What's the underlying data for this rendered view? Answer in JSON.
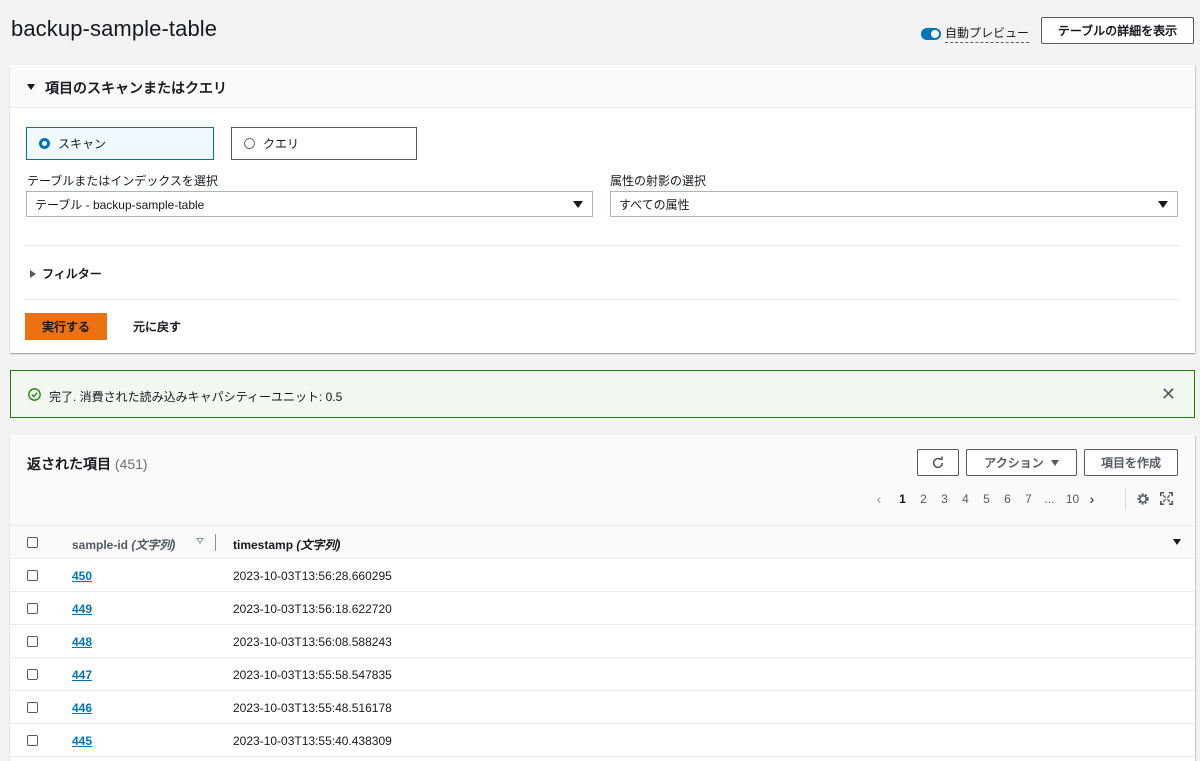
{
  "header": {
    "title": "backup-sample-table",
    "auto_preview_label": "自動プレビュー",
    "details_button": "テーブルの詳細を表示"
  },
  "scan_panel": {
    "title": "項目のスキャンまたはクエリ",
    "mode_scan": "スキャン",
    "mode_query": "クエリ",
    "selected_mode": "スキャン",
    "table_label": "テーブルまたはインデックスを選択",
    "table_value": "テーブル - backup-sample-table",
    "projection_label": "属性の射影の選択",
    "projection_value": "すべての属性",
    "filter_label": "フィルター",
    "run_button": "実行する",
    "reset_button": "元に戻す"
  },
  "flash": {
    "message": "完了. 消費された読み込みキャパシティーユニット: 0.5",
    "status_color": "#1d8102"
  },
  "results": {
    "title": "返された項目",
    "count": "(451)",
    "action_button": "アクション",
    "create_button": "項目を作成",
    "pagination": {
      "pages": [
        "1",
        "2",
        "3",
        "4",
        "5",
        "6",
        "7",
        "...",
        "10"
      ],
      "current": "1"
    },
    "columns": {
      "id": "sample-id",
      "id_type": "(文字列)",
      "timestamp": "timestamp",
      "timestamp_type": "(文字列)"
    },
    "rows": [
      {
        "id": "450",
        "timestamp": "2023-10-03T13:56:28.660295"
      },
      {
        "id": "449",
        "timestamp": "2023-10-03T13:56:18.622720"
      },
      {
        "id": "448",
        "timestamp": "2023-10-03T13:56:08.588243"
      },
      {
        "id": "447",
        "timestamp": "2023-10-03T13:55:58.547835"
      },
      {
        "id": "446",
        "timestamp": "2023-10-03T13:55:48.516178"
      },
      {
        "id": "445",
        "timestamp": "2023-10-03T13:55:40.438309"
      }
    ]
  },
  "colors": {
    "accent": "#0073bb",
    "primary_button": "#ec7211",
    "success": "#1d8102"
  }
}
